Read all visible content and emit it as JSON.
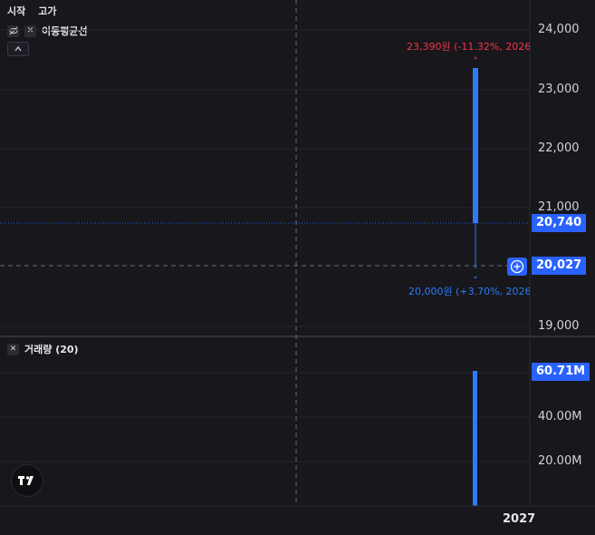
{
  "toolbar": {
    "open_label": "시작",
    "high_label": "고가"
  },
  "ma_legend": {
    "name": "이동평균선",
    "eye_icon": "eye-slash-icon",
    "close_icon": "close-icon"
  },
  "collapse": {
    "icon": "chevron-up-icon",
    "glyph": "^"
  },
  "price_axis": {
    "ticks": [
      "24,000",
      "23,000",
      "22,000",
      "21,000",
      "19,000"
    ]
  },
  "price_tags": {
    "last": "20,740",
    "cursor": "20,027"
  },
  "annotations": {
    "high": "23,390원 (-11.32%, 2026.",
    "low": "20,000원 (+3.70%, 2026.("
  },
  "volume_legend": {
    "title": "거래량 (20)",
    "close_icon": "close-icon"
  },
  "volume_axis": {
    "ticks": [
      "40.00M",
      "20.00M"
    ],
    "last": "60.71M"
  },
  "time_axis": {
    "label": "2027"
  },
  "logo": {
    "text": "TV",
    "icon": "tradingview-logo-icon"
  },
  "colors": {
    "background": "#17171c",
    "accent": "#2962ff",
    "up": "#2f7bf5",
    "down": "#f23645"
  },
  "chart_data": {
    "type": "candlestick",
    "price": {
      "open": 23390,
      "high": 23390,
      "low": 20000,
      "close": 20740,
      "ylim": [
        19000,
        24000
      ]
    },
    "volume": {
      "value": 60710000,
      "ylim": [
        0,
        60710000
      ]
    }
  }
}
